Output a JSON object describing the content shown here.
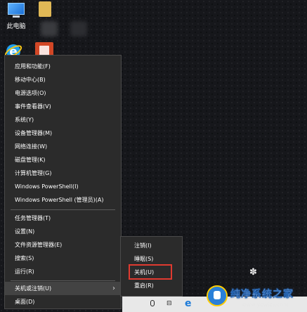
{
  "desktop": {
    "this_pc_label": "此电脑"
  },
  "context_menu": {
    "items": [
      {
        "label": "应用和功能(F)"
      },
      {
        "label": "移动中心(B)"
      },
      {
        "label": "电源选项(O)"
      },
      {
        "label": "事件查看器(V)"
      },
      {
        "label": "系统(Y)"
      },
      {
        "label": "设备管理器(M)"
      },
      {
        "label": "网络连接(W)"
      },
      {
        "label": "磁盘管理(K)"
      },
      {
        "label": "计算机管理(G)"
      },
      {
        "label": "Windows PowerShell(I)"
      },
      {
        "label": "Windows PowerShell (管理员)(A)"
      },
      {
        "label": "任务管理器(T)"
      },
      {
        "label": "设置(N)"
      },
      {
        "label": "文件资源管理器(E)"
      },
      {
        "label": "搜索(S)"
      },
      {
        "label": "运行(R)"
      },
      {
        "label": "关机或注销(U)"
      },
      {
        "label": "桌面(D)"
      }
    ],
    "submenu_arrow": "›"
  },
  "shutdown_submenu": {
    "items": [
      {
        "label": "注销(I)"
      },
      {
        "label": "睡眠(S)"
      },
      {
        "label": "关机(U)"
      },
      {
        "label": "重启(R)"
      }
    ]
  },
  "watermark": {
    "title": "纯净系统之家",
    "url": "www.ycwjzy.com"
  },
  "colors": {
    "menu_bg": "#2b2b2b",
    "highlight_border": "#e03a30",
    "taskbar_bg": "#e8e8e8"
  }
}
